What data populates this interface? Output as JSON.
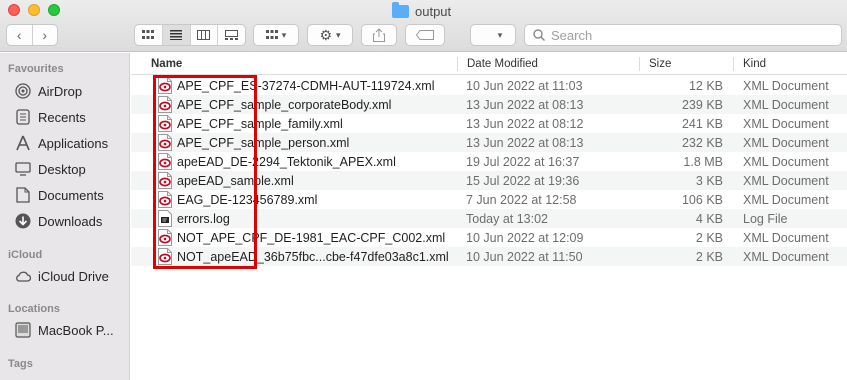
{
  "window": {
    "title": "output"
  },
  "toolbar": {
    "back_icon": "chevron-left-icon",
    "forward_icon": "chevron-right-icon",
    "search_placeholder": "Search"
  },
  "sidebar": {
    "favourites_header": "Favourites",
    "favourites": [
      {
        "label": "AirDrop",
        "icon": "airdrop-icon"
      },
      {
        "label": "Recents",
        "icon": "recents-icon"
      },
      {
        "label": "Applications",
        "icon": "applications-icon"
      },
      {
        "label": "Desktop",
        "icon": "desktop-icon"
      },
      {
        "label": "Documents",
        "icon": "documents-icon"
      },
      {
        "label": "Downloads",
        "icon": "downloads-icon"
      }
    ],
    "icloud_header": "iCloud",
    "icloud": [
      {
        "label": "iCloud Drive",
        "icon": "cloud-icon"
      }
    ],
    "locations_header": "Locations",
    "locations": [
      {
        "label": "MacBook P...",
        "icon": "laptop-icon"
      }
    ],
    "tags_header": "Tags"
  },
  "columns": {
    "name": "Name",
    "date": "Date Modified",
    "size": "Size",
    "kind": "Kind"
  },
  "files": [
    {
      "name": "APE_CPF_ES-37274-CDMH-AUT-119724.xml",
      "date": "10 Jun 2022 at 11:03",
      "size": "12 KB",
      "kind": "XML Document",
      "type": "xml"
    },
    {
      "name": "APE_CPF_sample_corporateBody.xml",
      "date": "13 Jun 2022 at 08:13",
      "size": "239 KB",
      "kind": "XML Document",
      "type": "xml"
    },
    {
      "name": "APE_CPF_sample_family.xml",
      "date": "13 Jun 2022 at 08:12",
      "size": "241 KB",
      "kind": "XML Document",
      "type": "xml"
    },
    {
      "name": "APE_CPF_sample_person.xml",
      "date": "13 Jun 2022 at 08:13",
      "size": "232 KB",
      "kind": "XML Document",
      "type": "xml"
    },
    {
      "name": "apeEAD_DE-2294_Tektonik_APEX.xml",
      "date": "19 Jul 2022 at 16:37",
      "size": "1.8 MB",
      "kind": "XML Document",
      "type": "xml"
    },
    {
      "name": "apeEAD_sample.xml",
      "date": "15 Jul 2022 at 19:36",
      "size": "3 KB",
      "kind": "XML Document",
      "type": "xml"
    },
    {
      "name": "EAG_DE-123456789.xml",
      "date": "7 Jun 2022 at 12:58",
      "size": "106 KB",
      "kind": "XML Document",
      "type": "xml"
    },
    {
      "name": "errors.log",
      "date": "Today at 13:02",
      "size": "4 KB",
      "kind": "Log File",
      "type": "log"
    },
    {
      "name": "NOT_APE_CPF_DE-1981_EAC-CPF_C002.xml",
      "date": "10 Jun 2022 at 12:09",
      "size": "2 KB",
      "kind": "XML Document",
      "type": "xml"
    },
    {
      "name": "NOT_apeEAD_36b75fbc...cbe-f47dfe03a8c1.xml",
      "date": "10 Jun 2022 at 11:50",
      "size": "2 KB",
      "kind": "XML Document",
      "type": "xml"
    }
  ],
  "colors": {
    "highlight_box": "#e00000",
    "folder": "#5aaef7",
    "xml_icon_accent": "#d0021b"
  }
}
